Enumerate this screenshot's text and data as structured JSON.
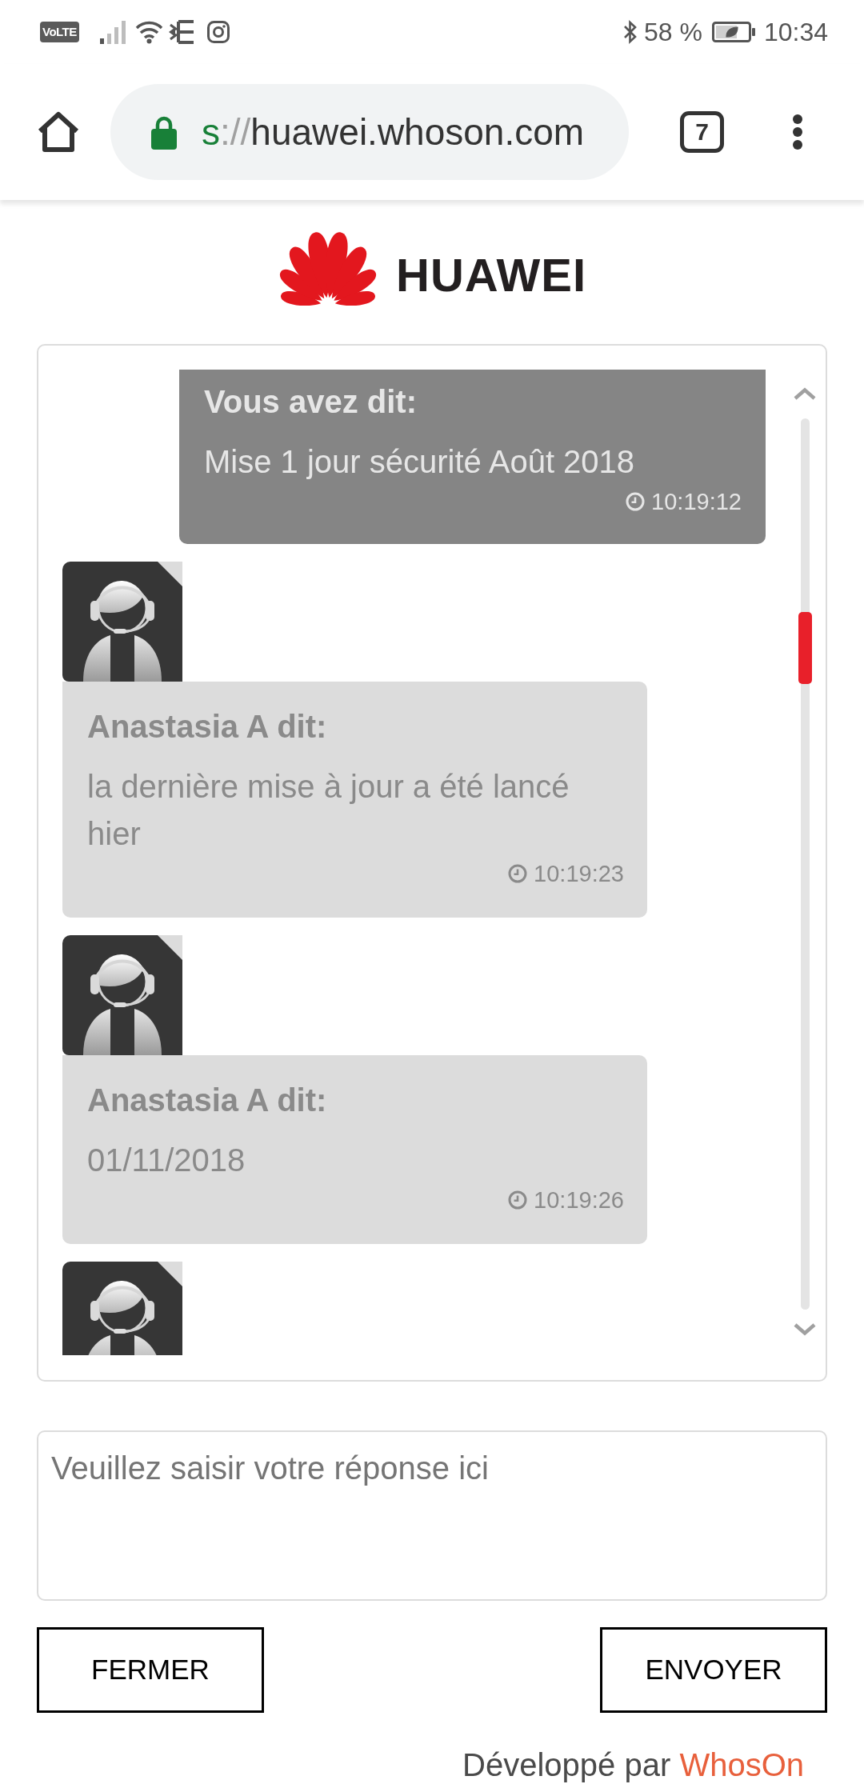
{
  "status_bar": {
    "network_badge": "VoLTE",
    "battery": "58 %",
    "time": "10:34"
  },
  "browser": {
    "url": {
      "scheme": "s",
      "separator": "://",
      "host": "huawei.whoson.com"
    },
    "tab_count": "7"
  },
  "logo": {
    "text": "HUAWEI"
  },
  "chat": {
    "messages": [
      {
        "kind": "visitor",
        "author": "Vous avez dit:",
        "text": "Mise 1 jour sécurité Août 2018",
        "time": "10:19:12"
      },
      {
        "kind": "agent",
        "author": "Anastasia A dit:",
        "text": "la dernière mise à jour a été lancé hier",
        "time": "10:19:23"
      },
      {
        "kind": "agent",
        "author": "Anastasia A dit:",
        "text": "01/11/2018",
        "time": "10:19:26"
      },
      {
        "kind": "agent"
      }
    ]
  },
  "reply": {
    "placeholder": "Veuillez saisir votre réponse ici"
  },
  "buttons": [
    "FERMER",
    "ENVOYER"
  ],
  "footer": {
    "text": "Développé par",
    "link": "WhosOn"
  }
}
